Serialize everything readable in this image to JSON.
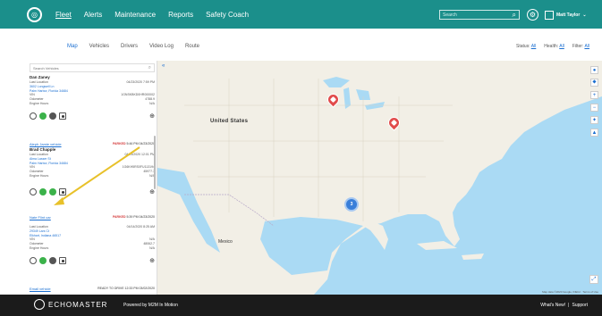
{
  "nav": {
    "links": [
      "Fleet",
      "Alerts",
      "Maintenance",
      "Reports",
      "Safety Coach"
    ],
    "search_placeholder": "Search",
    "user_name": "Matt Taylor"
  },
  "subnav": {
    "tabs": [
      "Map",
      "Vehicles",
      "Drivers",
      "Video Log",
      "Route"
    ],
    "status_label": "Status:",
    "status_value": "All",
    "health_label": "Health:",
    "health_value": "All",
    "filter_label": "Filter:",
    "filter_value": "All"
  },
  "sidebar": {
    "search_placeholder": "Search Vehicles",
    "vehicles": [
      {
        "driver": "Dan Zaney",
        "last_location_label": "Last Location",
        "last_location_time": "04/23/2020 7:59 PM",
        "address1": "3602 Longwell Ln",
        "address2": "Palm Harbor, Florida 34684",
        "vin_label": "VIN",
        "vin": "1GNSKBKD0HR000002",
        "odometer_label": "Odometer",
        "odometer": "4788.9",
        "engine_label": "Engine Hours",
        "engine": "N/A"
      },
      {
        "link": "Aleph Jamie vehicle",
        "status_word": "PARKED",
        "status_detail": "5:46 PM 04/23/2020",
        "driver": "Brad Chapple",
        "last_location_label": "Last Location",
        "last_location_time": "04/23/2020 12:01 PM",
        "address1": "Alma Lasser St",
        "address2": "Palm Harbor, Florida 34684",
        "vin_label": "VIN",
        "vin": "1G6KH5RS0FU113194",
        "odometer_label": "Odometer",
        "odometer": "45977.7",
        "engine_label": "Engine Hours",
        "engine": "N/A"
      },
      {
        "link": "Nate Flint car",
        "status_word": "PARKED",
        "status_detail": "5:39 PM 04/23/2020",
        "last_location_label": "Last Location",
        "last_location_time": "04/14/2020 8:25 AM",
        "address1": "29349 Lars Ct",
        "address2": "Elkhart, Indiana 46517",
        "vin_label": "VIN",
        "vin": "N/A",
        "odometer_label": "Odometer",
        "odometer": "48062.7",
        "engine_label": "Engine Hours",
        "engine": "N/A"
      }
    ],
    "bottom_link": "Email vehicle",
    "bottom_status": "READY TO DRIVE",
    "bottom_detail": "12:33 PM 03/02/2020"
  },
  "map": {
    "country_label": "United States",
    "mexico_label": "Mexico",
    "cluster_count": "3",
    "attribution": "Map data ©2020 Google, INEGI · Terms of Use"
  },
  "footer": {
    "brand": "ECHOMASTER",
    "powered_by": "Powered by M2M In Motion",
    "whats_new": "What's New!",
    "separator": "|",
    "support": "Support"
  },
  "colors": {
    "nav_bg": "#1b8f8b",
    "accent": "#1b6fd1",
    "parked": "#d43a3a",
    "footer_bg": "#1b1b1b"
  }
}
